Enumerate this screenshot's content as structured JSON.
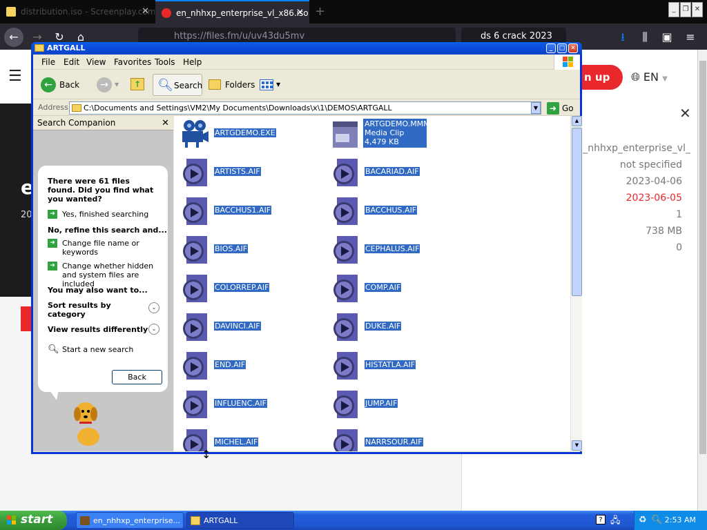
{
  "browser": {
    "tabs": [
      {
        "label": "distribution.iso - Screenplay.com.de",
        "active": false
      },
      {
        "label": "en_nhhxp_enterprise_vl_x86.iso |",
        "active": true
      }
    ],
    "new_tab": "+",
    "url": "https://files.fm/u/uv43du5mv",
    "search_text": "ds 6 crack 2023",
    "page_actions": "•••",
    "signup_label": "n up",
    "lang_label": "EN",
    "dark_title": "e",
    "dark_sub": "20",
    "info": {
      "filename": "en_nhhxp_enterprise_vl_",
      "category": "not specified",
      "date_uploaded": "2023-04-06",
      "date_expires": "2023-06-05",
      "count": "1",
      "size": "738 MB",
      "downloads": "0"
    }
  },
  "window": {
    "title": "ARTGALL",
    "menu": [
      "File",
      "Edit",
      "View",
      "Favorites",
      "Tools",
      "Help"
    ],
    "toolbar": {
      "back": "Back",
      "search": "Search",
      "folders": "Folders"
    },
    "address_label": "Address",
    "address": "C:\\Documents and Settings\\VM2\\My Documents\\Downloads\\x\\1\\DEMOS\\ARTGALL",
    "go_label": "Go"
  },
  "companion": {
    "title": "Search Companion",
    "found_text": "There were 61 files found. Did you find what you wanted?",
    "yes_finished": "Yes, finished searching",
    "refine_heading": "No, refine this search and...",
    "change_name": "Change file name or keywords",
    "change_hidden": "Change whether hidden and system files are included",
    "also_heading": "You may also want to...",
    "sort_category": "Sort results by category",
    "view_differently": "View results differently",
    "new_search": "Start a new search",
    "back_button": "Back"
  },
  "files": {
    "exe": "ARTGDEMO.EXE",
    "media": {
      "name": "ARTGDEMO.MMM",
      "type": "Media Clip",
      "size": "4,479 KB"
    },
    "left": [
      "ARTISTS.AIF",
      "BACCHUS1.AIF",
      "BIOS.AIF",
      "COLORREP.AIF",
      "DAVINCI.AIF",
      "END.AIF",
      "INFLUENC.AIF",
      "MICHEL.AIF"
    ],
    "right": [
      "BACARIAD.AIF",
      "BACCHUS.AIF",
      "CEPHALUS.AIF",
      "COMP.AIF",
      "DUKE.AIF",
      "HISTATLA.AIF",
      "JUMP.AIF",
      "NARRSOUR.AIF"
    ]
  },
  "taskbar": {
    "start": "start",
    "tasks": [
      "en_nhhxp_enterprise...",
      "ARTGALL"
    ],
    "clock": "2:53 AM"
  },
  "colors": {
    "selection": "#316ac5",
    "titlebar": "#0a5ee8",
    "taskbar": "#245edc",
    "start": "#3a9b3a",
    "accent_red": "#e8282b"
  }
}
